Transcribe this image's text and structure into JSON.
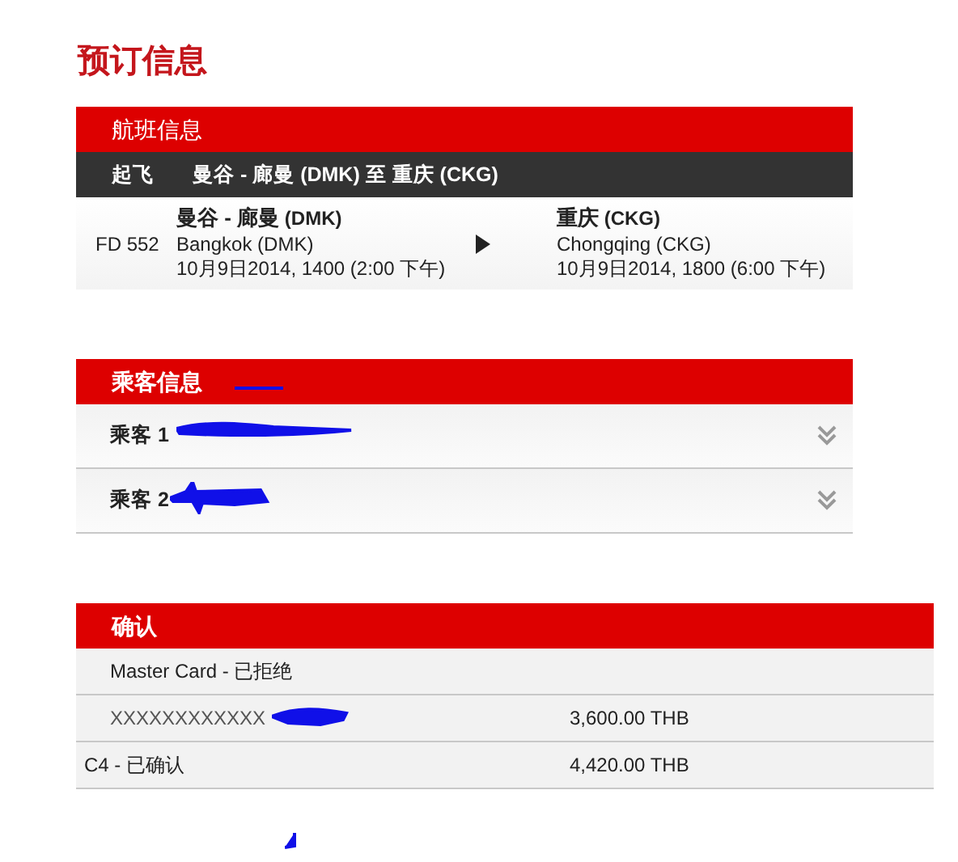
{
  "page_title": "预订信息",
  "flight": {
    "header": "航班信息",
    "bar_label": "起飞",
    "bar_route": "曼谷 - 廊曼 (DMK) 至 重庆 (CKG)",
    "flight_no": "FD 552",
    "origin": {
      "name": "曼谷 - 廊曼",
      "code": "(DMK)",
      "city": "Bangkok (DMK)",
      "time": "10月9日2014, 1400 (2:00 下午)"
    },
    "destination": {
      "name": "重庆",
      "code": "(CKG)",
      "city": "Chongqing (CKG)",
      "time": "10月9日2014, 1800 (6:00 下午)"
    }
  },
  "passengers": {
    "header": "乘客信息",
    "items": [
      {
        "label": "乘客 1",
        "expanded": false
      },
      {
        "label": "乘客 2",
        "expanded": false
      }
    ]
  },
  "confirmation": {
    "header": "确认",
    "rows": [
      {
        "kind": "card",
        "text": "Master Card - 已拒绝"
      },
      {
        "kind": "number",
        "text": "XXXXXXXXXXXX",
        "amount": "3,600.00 THB"
      },
      {
        "kind": "total",
        "text": "C4 - 已确认",
        "amount": "4,420.00 THB"
      }
    ]
  }
}
